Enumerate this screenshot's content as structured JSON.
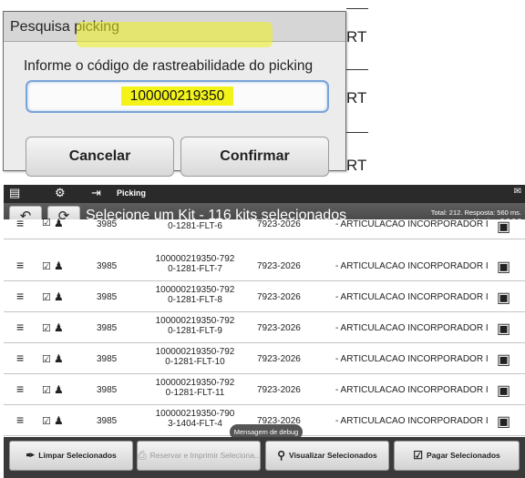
{
  "dialog": {
    "title": "Pesquisa picking",
    "message": "Informe o código de rastreabilidade do picking",
    "code_value": "100000219350",
    "cancel_label": "Cancelar",
    "confirm_label": "Confirmar",
    "background_fragment": "RT"
  },
  "statusbar": {
    "title": "Picking"
  },
  "toolbar": {
    "title_highlighted": "Selecione um Kit - 116 kits s",
    "title_rest": "elecionados",
    "total_line": "Total: 212. Resposta: 560 ms.",
    "version_line": "Version: 3.9.8.8"
  },
  "rows": [
    {
      "qty": "3985",
      "code_line1": "",
      "code_line2": "0-1281-FLT-6",
      "ref": "7923-2026",
      "desc": "- ARTICULACAO INCORPORADOR I"
    },
    {
      "qty": "3985",
      "code_line1": "100000219350-792",
      "code_line2": "0-1281-FLT-7",
      "ref": "7923-2026",
      "desc": "- ARTICULACAO INCORPORADOR I"
    },
    {
      "qty": "3985",
      "code_line1": "100000219350-792",
      "code_line2": "0-1281-FLT-8",
      "ref": "7923-2026",
      "desc": "- ARTICULACAO INCORPORADOR I"
    },
    {
      "qty": "3985",
      "code_line1": "100000219350-792",
      "code_line2": "0-1281-FLT-9",
      "ref": "7923-2026",
      "desc": "- ARTICULACAO INCORPORADOR I"
    },
    {
      "qty": "3985",
      "code_line1": "100000219350-792",
      "code_line2": "0-1281-FLT-10",
      "ref": "7923-2026",
      "desc": "- ARTICULACAO INCORPORADOR I"
    },
    {
      "qty": "3985",
      "code_line1": "100000219350-792",
      "code_line2": "0-1281-FLT-11",
      "ref": "7923-2026",
      "desc": "- ARTICULACAO INCORPORADOR I"
    },
    {
      "qty": "3985",
      "code_line1": "100000219350-790",
      "code_line2": "3-1404-FLT-4",
      "ref": "7923-2026",
      "desc": "- ARTICULACAO INCORPORADOR I"
    }
  ],
  "debug_tooltip": "Mensagem de debug",
  "bottom": {
    "clear_label": "Limpar Selecionados",
    "reserve_label": "Reservar e Imprimir Seleciona...",
    "view_label": "Visualizar Selecionados",
    "pay_label": "Pagar Selecionados"
  },
  "colors": {
    "highlight": "#f3f31a",
    "toolbar": "#4a4a4a",
    "input_border": "#7aa4d8"
  }
}
